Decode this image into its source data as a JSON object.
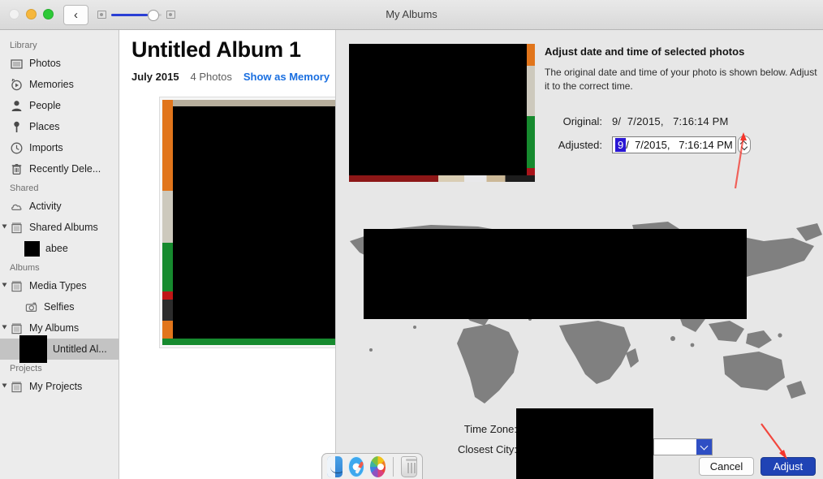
{
  "window": {
    "title": "My Albums",
    "back_label": "‹",
    "traffic": {
      "close": "close-button",
      "minimize": "minimize-button",
      "maximize": "maximize-button"
    },
    "zoom_slider": {
      "value": 72,
      "min_icon": "small-thumbnail-icon",
      "max_icon": "large-thumbnail-icon"
    }
  },
  "sidebar": {
    "sections": [
      {
        "header": "Library",
        "items": [
          {
            "label": "Photos",
            "icon": "photos-icon"
          },
          {
            "label": "Memories",
            "icon": "memories-icon"
          },
          {
            "label": "People",
            "icon": "people-icon"
          },
          {
            "label": "Places",
            "icon": "places-pin-icon"
          },
          {
            "label": "Imports",
            "icon": "imports-clock-icon"
          },
          {
            "label": "Recently Dele...",
            "icon": "trash-icon"
          }
        ]
      },
      {
        "header": "Shared",
        "items": [
          {
            "label": "Activity",
            "icon": "cloud-icon"
          },
          {
            "label": "Shared Albums",
            "icon": "album-stack-icon"
          },
          {
            "label": "abee",
            "icon": "album-thumbnail"
          }
        ]
      },
      {
        "header": "Albums",
        "items": [
          {
            "label": "Media Types",
            "icon": "album-stack-icon"
          },
          {
            "label": "Selfies",
            "icon": "selfies-camera-icon"
          },
          {
            "label": "My Albums",
            "icon": "album-stack-icon"
          },
          {
            "label": "Untitled Al...",
            "icon": "album-thumbnail"
          }
        ]
      },
      {
        "header": "Projects",
        "items": [
          {
            "label": "My Projects",
            "icon": "album-stack-icon"
          }
        ]
      }
    ]
  },
  "album": {
    "title": "Untitled Album 1",
    "date": "July 2015",
    "count": "4 Photos",
    "memory_link": "Show as Memory"
  },
  "sheet": {
    "heading": "Adjust date and time of selected photos",
    "description": "The original date and time of your photo is shown below. Adjust it to the correct time.",
    "original": {
      "label": "Original:",
      "value": "9/  7/2015,   7:16:14 PM"
    },
    "adjusted": {
      "label": "Adjusted:",
      "selected_segment": "9",
      "rest": "/  7/2015,   7:16:14 PM",
      "stepper": {
        "up": "stepper-up-icon",
        "down": "stepper-down-icon"
      }
    },
    "time_zone_label": "Time Zone:",
    "closest_city_label": "Closest City:",
    "closest_city_value": "",
    "buttons": {
      "cancel": "Cancel",
      "adjust": "Adjust"
    }
  },
  "colors": {
    "accent_blue": "#1f43b5",
    "link_blue": "#1a6fe0",
    "selection_blue": "#2a17d4",
    "annotation_red": "#f4352b",
    "map_land": "#808080",
    "sheet_bg": "#e7e7e7",
    "sidebar_bg": "#ececec"
  },
  "dock": {
    "items": [
      {
        "name": "finder",
        "label": "Finder"
      },
      {
        "name": "safari",
        "label": "Safari"
      },
      {
        "name": "photos",
        "label": "Photos"
      },
      {
        "name": "trash",
        "label": "Trash"
      }
    ]
  }
}
